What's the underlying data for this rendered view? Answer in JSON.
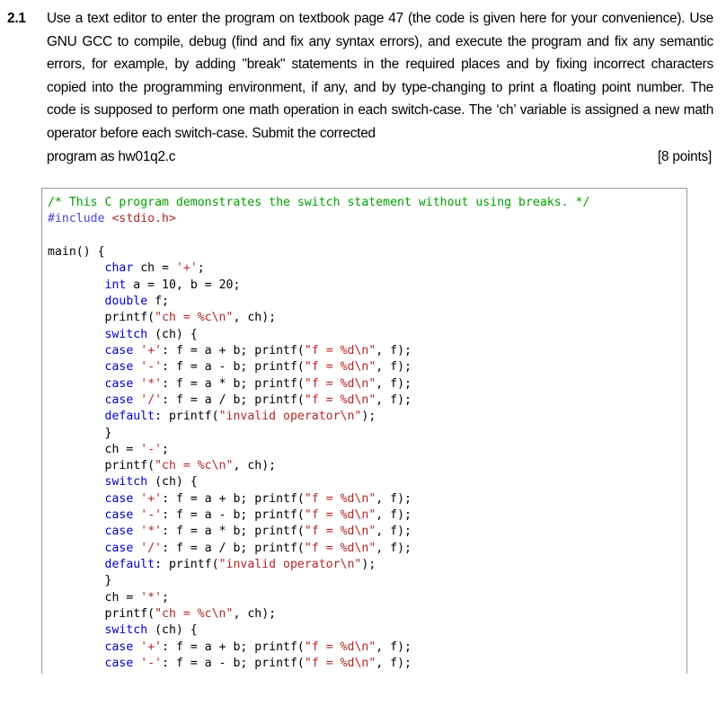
{
  "question": {
    "number": "2.1",
    "text": "Use a text editor to enter the program on textbook page 47 (the code is given here for your convenience). Use GNU GCC to compile, debug (find and fix any syntax errors), and execute the program and fix any semantic errors, for example, by adding \"break\" statements in the required places and by fixing incorrect characters copied into the programming environment, if any, and by type-changing to print a floating point number. The code is supposed to perform one math operation in each switch-case. The ‘ch’ variable is assigned a new math operator before each switch-case. Submit the corrected",
    "last_line": "program as hw01q2.c",
    "points": "[8 points]"
  },
  "code_block": {
    "language": "c",
    "colors": {
      "comment": "#00a000",
      "preprocessor": "#4646d6",
      "keyword": "#0000cd",
      "string": "#b42626",
      "plain": "#000000",
      "border": "#9a9a9a",
      "background": "#ffffff"
    },
    "lines": [
      "/* This C program demonstrates the switch statement without using breaks. */",
      "#include <stdio.h>",
      "",
      "main() {",
      "        char ch = '+';",
      "        int a = 10, b = 20;",
      "        double f;",
      "        printf(\"ch = %c\\n\", ch);",
      "        switch (ch) {",
      "        case '+': f = a + b; printf(\"f = %d\\n\", f);",
      "        case '-': f = a - b; printf(\"f = %d\\n\", f);",
      "        case '*': f = a * b; printf(\"f = %d\\n\", f);",
      "        case '/': f = a / b; printf(\"f = %d\\n\", f);",
      "        default: printf(\"invalid operator\\n\");",
      "        }",
      "        ch = '-';",
      "        printf(\"ch = %c\\n\", ch);",
      "        switch (ch) {",
      "        case '+': f = a + b; printf(\"f = %d\\n\", f);",
      "        case '-': f = a - b; printf(\"f = %d\\n\", f);",
      "        case '*': f = a * b; printf(\"f = %d\\n\", f);",
      "        case '/': f = a / b; printf(\"f = %d\\n\", f);",
      "        default: printf(\"invalid operator\\n\");",
      "        }",
      "        ch = '*';",
      "        printf(\"ch = %c\\n\", ch);",
      "        switch (ch) {",
      "        case '+': f = a + b; printf(\"f = %d\\n\", f);",
      "        case '-': f = a - b; printf(\"f = %d\\n\", f);"
    ]
  }
}
